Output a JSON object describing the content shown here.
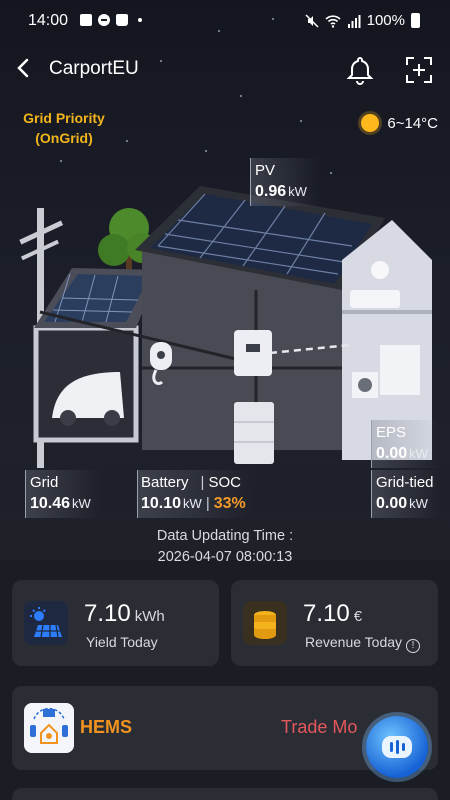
{
  "status_bar": {
    "time": "14:00",
    "battery": "100%"
  },
  "header": {
    "title": "CarportEU"
  },
  "mode": {
    "line1": "Grid Priority",
    "line2": "(OnGrid)"
  },
  "weather": {
    "temperature": "6~14°C"
  },
  "pv": {
    "label": "PV",
    "value": "0.96",
    "unit": "kW"
  },
  "grid": {
    "label": "Grid",
    "value": "10.46",
    "unit": "kW"
  },
  "battery": {
    "label": "Battery",
    "soc_label": "SOC",
    "value": "10.10",
    "unit": "kW",
    "soc": "33%"
  },
  "eps": {
    "label": "EPS",
    "value": "0.00",
    "unit": "kW"
  },
  "grid_tied": {
    "label": "Grid-tied",
    "value": "0.00",
    "unit": "kW"
  },
  "update": {
    "label": "Data Updating Time :",
    "time": "2026-04-07 08:00:13"
  },
  "yield_card": {
    "value": "7.10",
    "unit": "kWh",
    "label": "Yield Today"
  },
  "revenue_card": {
    "value": "7.10",
    "unit": "€",
    "label": "Revenue Today"
  },
  "hems": {
    "label": "HEMS",
    "trade_label": "Trade Mo"
  },
  "colors": {
    "accent_orange": "#f3b51c",
    "soc_orange": "#f39a2b",
    "trade_red": "#e2585c",
    "card_bg": "#2b2d35"
  },
  "icons": [
    "back-arrow-icon",
    "bell-icon",
    "scan-add-icon",
    "sun-icon",
    "solar-panel-icon",
    "coins-icon",
    "hems-icon",
    "assistant-icon"
  ]
}
